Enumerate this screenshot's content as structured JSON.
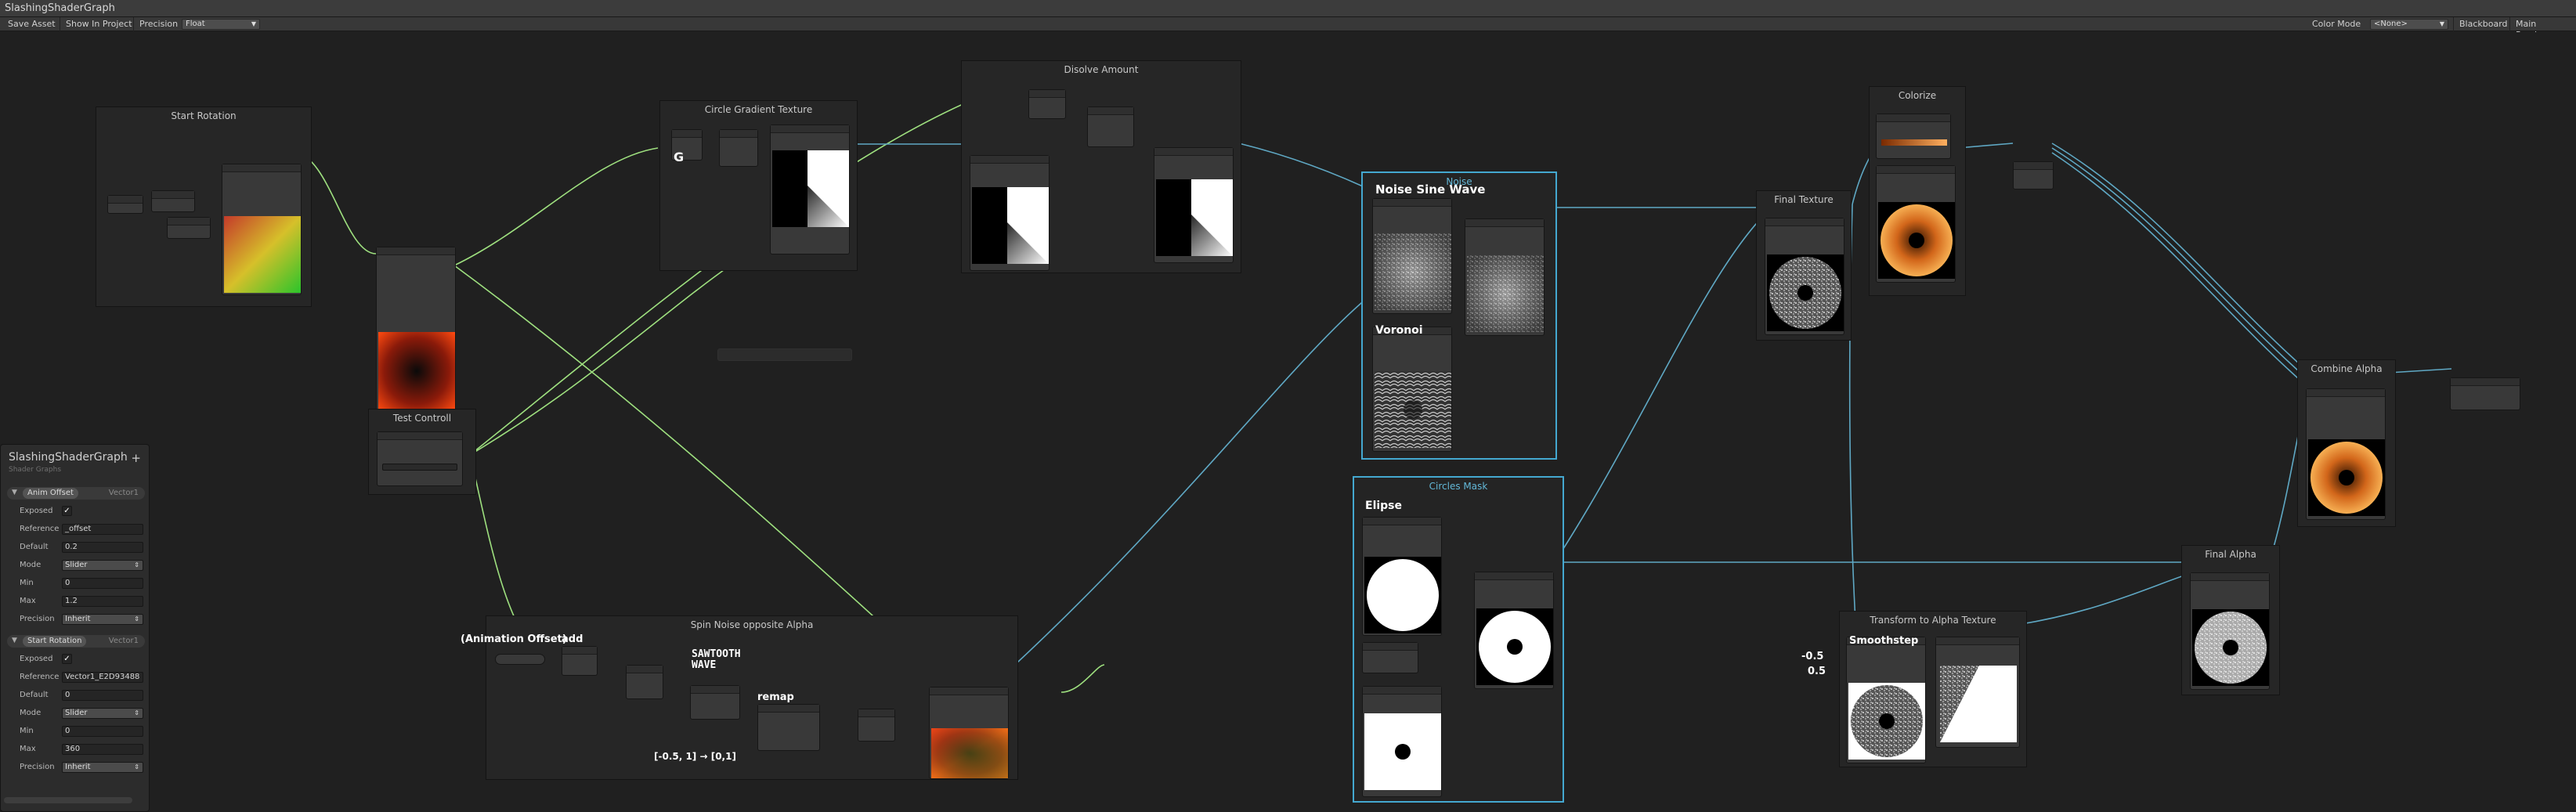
{
  "window": {
    "title": "SlashingShaderGraph"
  },
  "toolbar": {
    "save_asset": "Save Asset",
    "show_in_project": "Show In Project",
    "precision_label": "Precision",
    "precision_value": "Float",
    "color_mode_label": "Color Mode",
    "color_mode_value": "<None>",
    "blackboard": "Blackboard",
    "main_preview": "Main Preview"
  },
  "groups": {
    "start_rotation": "Start Rotation",
    "circle_gradient": "Circle Gradient Texture",
    "dissolve": "Disolve Amount",
    "noise": "Noise",
    "test_controll": "Test Controll",
    "spin_noise": "Spin Noise opposite Alpha",
    "circles_mask": "Circles Mask",
    "final_texture": "Final Texture",
    "colorize": "Colorize",
    "combine_alpha": "Combine Alpha",
    "final_alpha": "Final Alpha",
    "transform_alpha": "Transform to Alpha Texture"
  },
  "annotations": {
    "noise_sine_wave": "Noise Sine Wave",
    "voronoi": "Voronoi",
    "g": "G",
    "elipse": "Elipse",
    "animation_offset": "(Animation Offset)",
    "add": "add",
    "sawtooth": "SAWTOOTH\nWAVE",
    "remap": "remap",
    "remap_range": "[-0.5, 1]  → [0,1]",
    "smoothstep": "Smoothstep",
    "neg_half": "-0.5",
    "half": "0.5"
  },
  "blackboard": {
    "title": "SlashingShaderGraph",
    "subtitle": "Shader Graphs",
    "add_icon": "plus-icon",
    "properties": [
      {
        "name": "Anim Offset",
        "type": "Vector1",
        "exposed": "✓",
        "reference": "_offset",
        "default": "0.2",
        "mode": "Slider",
        "min": "0",
        "max": "1.2",
        "precision": "Inherit"
      },
      {
        "name": "Start Rotation",
        "type": "Vector1",
        "exposed": "✓",
        "reference": "Vector1_E2D93488",
        "default": "0",
        "mode": "Slider",
        "min": "0",
        "max": "360",
        "precision": "Inherit"
      }
    ],
    "labels": {
      "exposed": "Exposed",
      "reference": "Reference",
      "default": "Default",
      "mode": "Mode",
      "min": "Min",
      "max": "Max",
      "precision": "Precision"
    }
  },
  "colors": {
    "canvas": "#202020",
    "group_select": "#44a8d0",
    "edge_blue": "#5fa8c4",
    "edge_green": "#9ee07f"
  }
}
